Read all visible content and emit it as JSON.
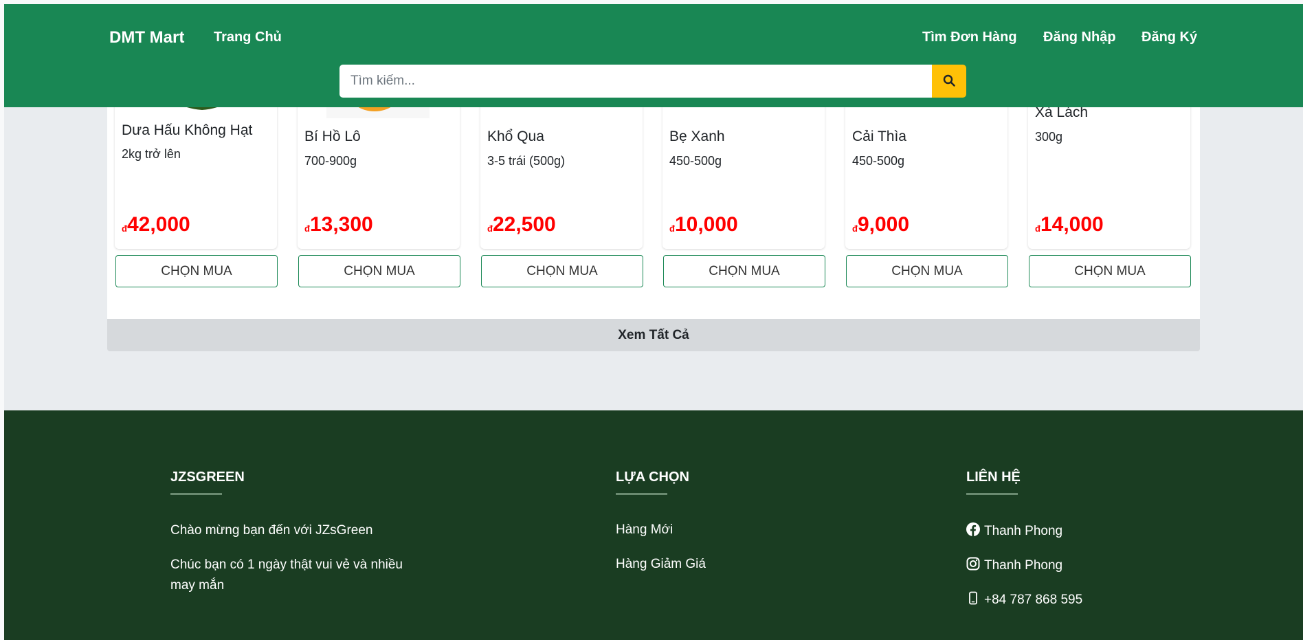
{
  "header": {
    "brand": "DMT Mart",
    "nav_home": "Trang Chủ",
    "nav_right": [
      "Tìm Đơn Hàng",
      "Đăng Nhập",
      "Đăng Ký"
    ],
    "search_placeholder": "Tìm kiếm...",
    "search_icon": "search-icon"
  },
  "products": [
    {
      "name": "Dưa Hấu Không Hạt",
      "weight": "2kg trở lên",
      "currency": "đ",
      "price": "42,000",
      "button": "CHỌN MUA"
    },
    {
      "name": "Bí Hồ Lô",
      "weight": "700-900g",
      "currency": "đ",
      "price": "13,300",
      "button": "CHỌN MUA"
    },
    {
      "name": "Khổ Qua",
      "weight": "3-5 trái (500g)",
      "currency": "đ",
      "price": "22,500",
      "button": "CHỌN MUA"
    },
    {
      "name": "Bẹ Xanh",
      "weight": "450-500g",
      "currency": "đ",
      "price": "10,000",
      "button": "CHỌN MUA"
    },
    {
      "name": "Cải Thìa",
      "weight": "450-500g",
      "currency": "đ",
      "price": "9,000",
      "button": "CHỌN MUA"
    },
    {
      "name": "Xà Lách",
      "weight": "300g",
      "currency": "đ",
      "price": "14,000",
      "button": "CHỌN MUA"
    }
  ],
  "see_all": "Xem Tất Cả",
  "footer": {
    "col1": {
      "heading": "JZSGREEN",
      "lines": [
        "Chào mừng bạn đến với JZsGreen",
        "Chúc bạn có 1 ngày thật vui vẻ và nhiều may mắn"
      ]
    },
    "col2": {
      "heading": "LỰA CHỌN",
      "links": [
        "Hàng Mới",
        "Hàng Giảm Giá"
      ]
    },
    "col3": {
      "heading": "LIÊN HỆ",
      "contacts": [
        {
          "icon": "facebook-icon",
          "text": "Thanh Phong"
        },
        {
          "icon": "instagram-icon",
          "text": "Thanh Phong"
        },
        {
          "icon": "phone-icon",
          "text": "+84 787 868 595"
        }
      ]
    }
  },
  "colors": {
    "header_green": "#198754",
    "footer_green": "#1a3d22",
    "price_red": "#ff0000",
    "search_button": "#ffc107"
  }
}
